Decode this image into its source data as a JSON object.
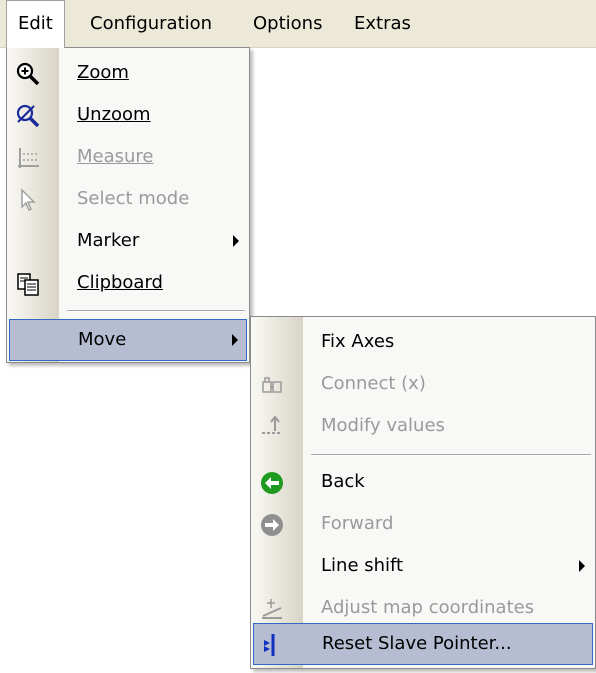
{
  "menubar": {
    "items": [
      "Edit",
      "Configuration",
      "Options",
      "Extras"
    ]
  },
  "edit_menu": {
    "items": [
      {
        "label": "Zoom",
        "mnemonic": "Z",
        "icon": "zoom-in-icon",
        "enabled": true
      },
      {
        "label": "Unzoom",
        "mnemonic": "U",
        "icon": "unzoom-icon",
        "enabled": true
      },
      {
        "label": "Measure",
        "mnemonic": "M",
        "icon": "measure-icon",
        "enabled": false
      },
      {
        "label": "Select mode",
        "icon": "pointer-icon",
        "enabled": false
      },
      {
        "label": "Marker",
        "submenu": true,
        "enabled": true
      },
      {
        "label": "Clipboard",
        "mnemonic": "C",
        "icon": "clipboard-icon",
        "enabled": true
      },
      {
        "label": "Move",
        "submenu": true,
        "enabled": true,
        "highlighted": true
      }
    ]
  },
  "move_menu": {
    "items": [
      {
        "label": "Fix Axes",
        "mnemonic": "F",
        "enabled": true
      },
      {
        "label": "Connect (x)",
        "icon": "connect-icon",
        "enabled": false
      },
      {
        "label": "Modify values",
        "icon": "modify-values-icon",
        "enabled": false
      },
      {
        "label": "Back",
        "icon": "back-arrow-icon",
        "enabled": true
      },
      {
        "label": "Forward",
        "icon": "forward-arrow-icon",
        "enabled": false
      },
      {
        "label": "Line shift",
        "submenu": true,
        "enabled": true
      },
      {
        "label": "Adjust map coordinates",
        "icon": "adjust-map-icon",
        "enabled": false
      },
      {
        "label": "Reset Slave Pointer...",
        "mnemonic": "l",
        "icon": "slave-pointer-icon",
        "enabled": true,
        "highlighted": true
      }
    ]
  },
  "colors": {
    "highlight_bg": "#b6bdd2",
    "highlight_border": "#316ac5",
    "back_green": "#1e9a1e",
    "disabled_text": "#9a9a9a"
  }
}
